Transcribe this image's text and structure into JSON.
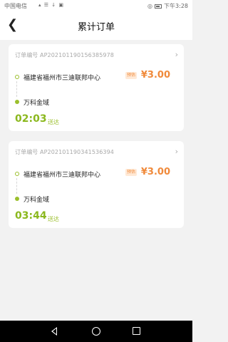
{
  "status_bar": {
    "carrier": "中国电信",
    "icons": "▴ ☰ ↓ ▣",
    "time": "下午3:28"
  },
  "header": {
    "back_icon": "chevron-left-icon",
    "title": "累计订单"
  },
  "orders": [
    {
      "order_no": "订单编号 AP202101190156385978",
      "from": "福建省福州市三迪联邦中心",
      "to": "万科金域",
      "tag": "预估",
      "price": "¥3.00",
      "time": "02:03",
      "time_label": "送达"
    },
    {
      "order_no": "订单编号 AP202101190341536394",
      "from": "福建省福州市三迪联邦中心",
      "to": "万科金域",
      "tag": "预估",
      "price": "¥3.00",
      "time": "03:44",
      "time_label": "送达"
    }
  ],
  "nav_bar": {
    "back_icon": "triangle-back-icon",
    "home_icon": "circle-home-icon",
    "recent_icon": "square-recent-icon"
  },
  "colors": {
    "accent_green": "#8bb81e",
    "price_orange": "#f08a3b"
  }
}
